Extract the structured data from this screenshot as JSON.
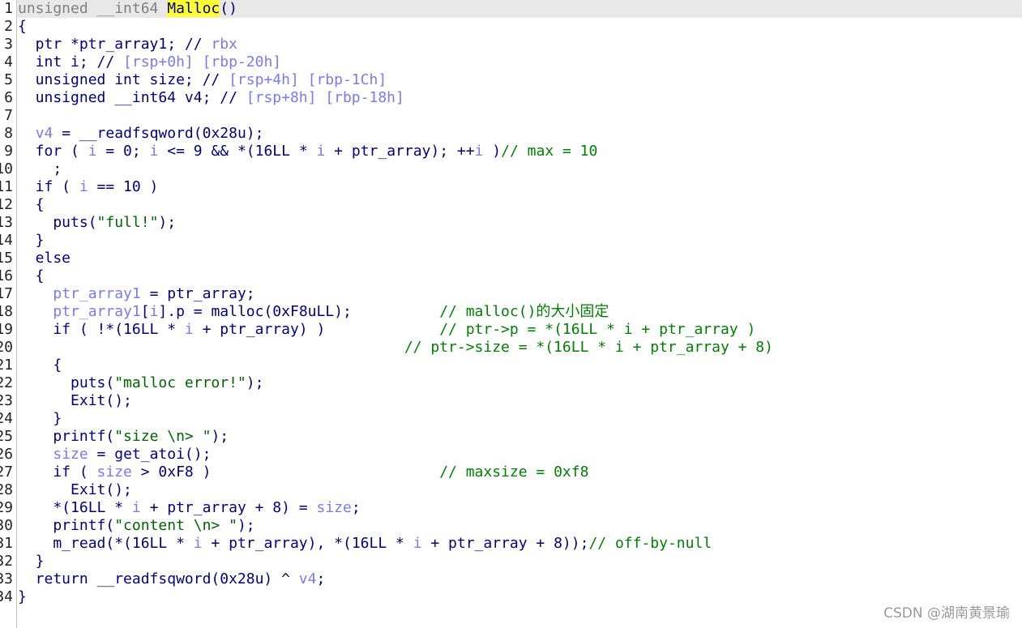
{
  "editor": {
    "highlight_color": "#ffff33",
    "lines": [
      {
        "n": "1",
        "tokens": [
          {
            "t": "unsigned __int64 ",
            "c": "gray"
          },
          {
            "t": "Malloc",
            "c": "hl"
          },
          {
            "t": "()",
            "c": "plain"
          }
        ]
      },
      {
        "n": "2",
        "tokens": [
          {
            "t": "{",
            "c": "plain"
          }
        ]
      },
      {
        "n": "3",
        "tokens": [
          {
            "t": "  ptr *ptr_array1; // ",
            "c": "plain"
          },
          {
            "t": "rbx",
            "c": "var"
          }
        ]
      },
      {
        "n": "4",
        "tokens": [
          {
            "t": "  int i; // ",
            "c": "plain"
          },
          {
            "t": "[rsp+0h] [rbp-20h]",
            "c": "var"
          }
        ]
      },
      {
        "n": "5",
        "tokens": [
          {
            "t": "  unsigned int size; // ",
            "c": "plain"
          },
          {
            "t": "[rsp+4h] [rbp-1Ch]",
            "c": "var"
          }
        ]
      },
      {
        "n": "6",
        "tokens": [
          {
            "t": "  unsigned __int64 v4; // ",
            "c": "plain"
          },
          {
            "t": "[rsp+8h] [rbp-18h]",
            "c": "var"
          }
        ]
      },
      {
        "n": "7",
        "tokens": [
          {
            "t": "",
            "c": "plain"
          }
        ]
      },
      {
        "n": "8",
        "tokens": [
          {
            "t": "  ",
            "c": "plain"
          },
          {
            "t": "v4",
            "c": "var"
          },
          {
            "t": " = __readfsqword(0x28u);",
            "c": "plain"
          }
        ]
      },
      {
        "n": "9",
        "tokens": [
          {
            "t": "  for ( ",
            "c": "plain"
          },
          {
            "t": "i",
            "c": "var"
          },
          {
            "t": " = 0; ",
            "c": "plain"
          },
          {
            "t": "i",
            "c": "var"
          },
          {
            "t": " <= 9 && *(16LL * ",
            "c": "plain"
          },
          {
            "t": "i",
            "c": "var"
          },
          {
            "t": " + ptr_array); ++",
            "c": "plain"
          },
          {
            "t": "i",
            "c": "var"
          },
          {
            "t": " )",
            "c": "plain"
          },
          {
            "t": "// max = 10",
            "c": "cmt"
          }
        ]
      },
      {
        "n": "10",
        "tokens": [
          {
            "t": "    ;",
            "c": "plain"
          }
        ]
      },
      {
        "n": "11",
        "tokens": [
          {
            "t": "  if ( ",
            "c": "plain"
          },
          {
            "t": "i",
            "c": "var"
          },
          {
            "t": " == 10 )",
            "c": "plain"
          }
        ]
      },
      {
        "n": "12",
        "tokens": [
          {
            "t": "  {",
            "c": "plain"
          }
        ]
      },
      {
        "n": "13",
        "tokens": [
          {
            "t": "    puts(",
            "c": "plain"
          },
          {
            "t": "\"full!\"",
            "c": "str"
          },
          {
            "t": ");",
            "c": "plain"
          }
        ]
      },
      {
        "n": "14",
        "tokens": [
          {
            "t": "  }",
            "c": "plain"
          }
        ]
      },
      {
        "n": "15",
        "tokens": [
          {
            "t": "  else",
            "c": "plain"
          }
        ]
      },
      {
        "n": "16",
        "tokens": [
          {
            "t": "  {",
            "c": "plain"
          }
        ]
      },
      {
        "n": "17",
        "tokens": [
          {
            "t": "    ",
            "c": "plain"
          },
          {
            "t": "ptr_array1",
            "c": "var"
          },
          {
            "t": " = ptr_array;",
            "c": "plain"
          }
        ]
      },
      {
        "n": "18",
        "tokens": [
          {
            "t": "    ",
            "c": "plain"
          },
          {
            "t": "ptr_array1",
            "c": "var"
          },
          {
            "t": "[",
            "c": "plain"
          },
          {
            "t": "i",
            "c": "var"
          },
          {
            "t": "].p = malloc(0xF8uLL);          ",
            "c": "plain"
          },
          {
            "t": "// malloc()的大小固定",
            "c": "cmt"
          }
        ]
      },
      {
        "n": "19",
        "tokens": [
          {
            "t": "    if ( !*(16LL * ",
            "c": "plain"
          },
          {
            "t": "i",
            "c": "var"
          },
          {
            "t": " + ptr_array) )             ",
            "c": "plain"
          },
          {
            "t": "// ptr->p = *(16LL * i + ptr_array )",
            "c": "cmt"
          }
        ]
      },
      {
        "n": "20",
        "tokens": [
          {
            "t": "                                            ",
            "c": "plain"
          },
          {
            "t": "// ptr->size = *(16LL * i + ptr_array + 8)",
            "c": "cmt"
          }
        ]
      },
      {
        "n": "21",
        "tokens": [
          {
            "t": "    {",
            "c": "plain"
          }
        ]
      },
      {
        "n": "22",
        "tokens": [
          {
            "t": "      puts(",
            "c": "plain"
          },
          {
            "t": "\"malloc error!\"",
            "c": "str"
          },
          {
            "t": ");",
            "c": "plain"
          }
        ]
      },
      {
        "n": "23",
        "tokens": [
          {
            "t": "      Exit();",
            "c": "plain"
          }
        ]
      },
      {
        "n": "24",
        "tokens": [
          {
            "t": "    }",
            "c": "plain"
          }
        ]
      },
      {
        "n": "25",
        "tokens": [
          {
            "t": "    printf(",
            "c": "plain"
          },
          {
            "t": "\"size \\n> \"",
            "c": "str"
          },
          {
            "t": ");",
            "c": "plain"
          }
        ]
      },
      {
        "n": "26",
        "tokens": [
          {
            "t": "    ",
            "c": "plain"
          },
          {
            "t": "size",
            "c": "var"
          },
          {
            "t": " = get_atoi();",
            "c": "plain"
          }
        ]
      },
      {
        "n": "27",
        "tokens": [
          {
            "t": "    if ( ",
            "c": "plain"
          },
          {
            "t": "size",
            "c": "var"
          },
          {
            "t": " > 0xF8 )                          ",
            "c": "plain"
          },
          {
            "t": "// maxsize = 0xf8",
            "c": "cmt"
          }
        ]
      },
      {
        "n": "28",
        "tokens": [
          {
            "t": "      Exit();",
            "c": "plain"
          }
        ]
      },
      {
        "n": "29",
        "tokens": [
          {
            "t": "    *(16LL * ",
            "c": "plain"
          },
          {
            "t": "i",
            "c": "var"
          },
          {
            "t": " + ptr_array + 8) = ",
            "c": "plain"
          },
          {
            "t": "size",
            "c": "var"
          },
          {
            "t": ";",
            "c": "plain"
          }
        ]
      },
      {
        "n": "30",
        "tokens": [
          {
            "t": "    printf(",
            "c": "plain"
          },
          {
            "t": "\"content \\n> \"",
            "c": "str"
          },
          {
            "t": ");",
            "c": "plain"
          }
        ]
      },
      {
        "n": "31",
        "tokens": [
          {
            "t": "    m_read(*(16LL * ",
            "c": "plain"
          },
          {
            "t": "i",
            "c": "var"
          },
          {
            "t": " + ptr_array), *(16LL * ",
            "c": "plain"
          },
          {
            "t": "i",
            "c": "var"
          },
          {
            "t": " + ptr_array + 8));",
            "c": "plain"
          },
          {
            "t": "// off-by-null",
            "c": "cmt"
          }
        ]
      },
      {
        "n": "32",
        "tokens": [
          {
            "t": "  }",
            "c": "plain"
          }
        ]
      },
      {
        "n": "33",
        "tokens": [
          {
            "t": "  return __readfsqword(0x28u) ^ ",
            "c": "plain"
          },
          {
            "t": "v4",
            "c": "var"
          },
          {
            "t": ";",
            "c": "plain"
          }
        ]
      },
      {
        "n": "34",
        "tokens": [
          {
            "t": "}",
            "c": "plain"
          }
        ]
      }
    ]
  },
  "watermark": "CSDN @湖南黄景瑜"
}
